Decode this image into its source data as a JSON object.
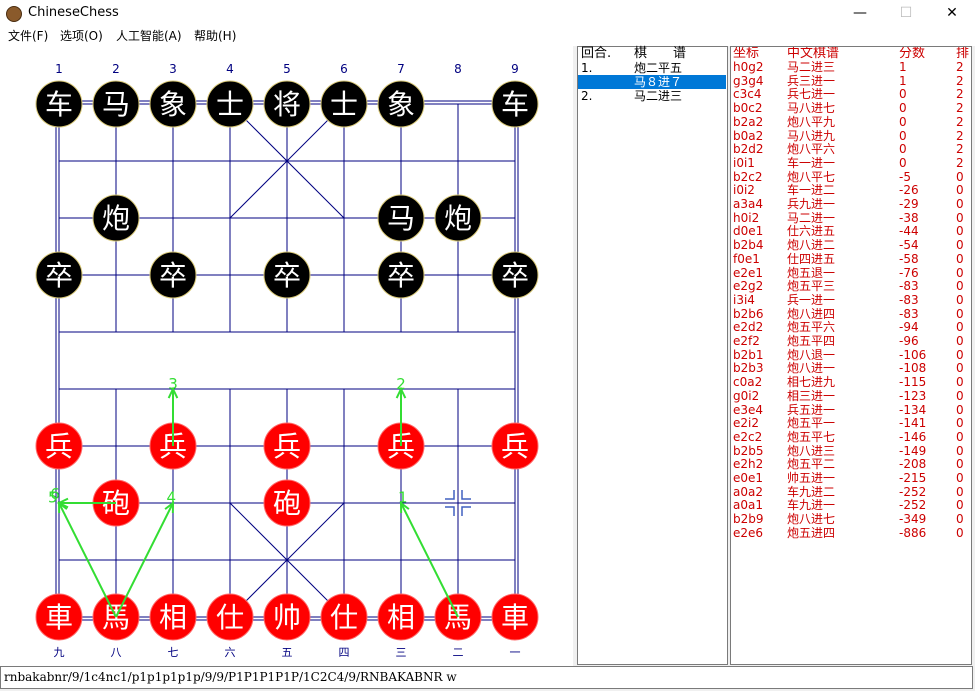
{
  "window": {
    "title": "ChineseChess",
    "minimize": "—",
    "maximize": "☐",
    "close": "✕"
  },
  "menu": [
    "文件(F)",
    "选项(O)",
    "人工智能(A)",
    "帮助(H)"
  ],
  "board": {
    "top_numbers": [
      "1",
      "2",
      "3",
      "4",
      "5",
      "6",
      "7",
      "8",
      "9"
    ],
    "bottom_numbers": [
      "九",
      "八",
      "七",
      "六",
      "五",
      "四",
      "三",
      "二",
      "一"
    ],
    "black_color": "#000000",
    "red_color": "#ff0000",
    "grid_color": "#000080",
    "arrow_color": "#33dd33",
    "pieces": [
      {
        "side": "black",
        "char": "车",
        "col": 1,
        "row": 1
      },
      {
        "side": "black",
        "char": "马",
        "col": 2,
        "row": 1
      },
      {
        "side": "black",
        "char": "象",
        "col": 3,
        "row": 1
      },
      {
        "side": "black",
        "char": "士",
        "col": 4,
        "row": 1
      },
      {
        "side": "black",
        "char": "将",
        "col": 5,
        "row": 1
      },
      {
        "side": "black",
        "char": "士",
        "col": 6,
        "row": 1
      },
      {
        "side": "black",
        "char": "象",
        "col": 7,
        "row": 1
      },
      {
        "side": "black",
        "char": "车",
        "col": 9,
        "row": 1
      },
      {
        "side": "black",
        "char": "炮",
        "col": 2,
        "row": 3
      },
      {
        "side": "black",
        "char": "马",
        "col": 7,
        "row": 3
      },
      {
        "side": "black",
        "char": "炮",
        "col": 8,
        "row": 3
      },
      {
        "side": "black",
        "char": "卒",
        "col": 1,
        "row": 4
      },
      {
        "side": "black",
        "char": "卒",
        "col": 3,
        "row": 4
      },
      {
        "side": "black",
        "char": "卒",
        "col": 5,
        "row": 4
      },
      {
        "side": "black",
        "char": "卒",
        "col": 7,
        "row": 4
      },
      {
        "side": "black",
        "char": "卒",
        "col": 9,
        "row": 4
      },
      {
        "side": "red",
        "char": "兵",
        "col": 1,
        "row": 7
      },
      {
        "side": "red",
        "char": "兵",
        "col": 3,
        "row": 7
      },
      {
        "side": "red",
        "char": "兵",
        "col": 5,
        "row": 7
      },
      {
        "side": "red",
        "char": "兵",
        "col": 7,
        "row": 7
      },
      {
        "side": "red",
        "char": "兵",
        "col": 9,
        "row": 7
      },
      {
        "side": "red",
        "char": "砲",
        "col": 2,
        "row": 8
      },
      {
        "side": "red",
        "char": "砲",
        "col": 5,
        "row": 8
      },
      {
        "side": "red",
        "char": "車",
        "col": 1,
        "row": 10
      },
      {
        "side": "red",
        "char": "馬",
        "col": 2,
        "row": 10
      },
      {
        "side": "red",
        "char": "相",
        "col": 3,
        "row": 10
      },
      {
        "side": "red",
        "char": "仕",
        "col": 4,
        "row": 10
      },
      {
        "side": "red",
        "char": "帅",
        "col": 5,
        "row": 10
      },
      {
        "side": "red",
        "char": "仕",
        "col": 6,
        "row": 10
      },
      {
        "side": "red",
        "char": "相",
        "col": 7,
        "row": 10
      },
      {
        "side": "red",
        "char": "馬",
        "col": 8,
        "row": 10
      },
      {
        "side": "red",
        "char": "車",
        "col": 9,
        "row": 10
      }
    ],
    "arrows": [
      {
        "label": "1",
        "from": [
          8,
          10
        ],
        "to": [
          7,
          8
        ]
      },
      {
        "label": "2",
        "from": [
          7,
          7
        ],
        "to": [
          7,
          6
        ]
      },
      {
        "label": "3",
        "from": [
          3,
          7
        ],
        "to": [
          3,
          6
        ]
      },
      {
        "label": "4",
        "from": [
          2,
          10
        ],
        "to": [
          3,
          8
        ]
      },
      {
        "label": "5",
        "from": [
          2,
          10
        ],
        "to": [
          1,
          8
        ]
      },
      {
        "label": "6",
        "from": [
          2,
          8
        ],
        "to": [
          1,
          8
        ]
      }
    ],
    "marker": {
      "col": 8,
      "row": 8
    }
  },
  "moves": {
    "header_round": "回合.",
    "header_notation": "棋　　谱",
    "rows": [
      {
        "num": "1.",
        "text": "炮二平五",
        "selected": false
      },
      {
        "num": "",
        "text": "马８进７",
        "selected": true
      },
      {
        "num": "2.",
        "text": "马二进三",
        "selected": false
      }
    ]
  },
  "eval": {
    "headers": [
      "坐标",
      "中文棋谱",
      "分数",
      "排"
    ],
    "rows": [
      [
        "h0g2",
        "马二进三",
        "1",
        "2"
      ],
      [
        "g3g4",
        "兵三进一",
        "1",
        "2"
      ],
      [
        "c3c4",
        "兵七进一",
        "0",
        "2"
      ],
      [
        "b0c2",
        "马八进七",
        "0",
        "2"
      ],
      [
        "b2a2",
        "炮八平九",
        "0",
        "2"
      ],
      [
        "b0a2",
        "马八进九",
        "0",
        "2"
      ],
      [
        "b2d2",
        "炮八平六",
        "0",
        "2"
      ],
      [
        "i0i1",
        "车一进一",
        "0",
        "2"
      ],
      [
        "b2c2",
        "炮八平七",
        "-5",
        "0"
      ],
      [
        "i0i2",
        "车一进二",
        "-26",
        "0"
      ],
      [
        "a3a4",
        "兵九进一",
        "-29",
        "0"
      ],
      [
        "h0i2",
        "马二进一",
        "-38",
        "0"
      ],
      [
        "d0e1",
        "仕六进五",
        "-44",
        "0"
      ],
      [
        "b2b4",
        "炮八进二",
        "-54",
        "0"
      ],
      [
        "f0e1",
        "仕四进五",
        "-58",
        "0"
      ],
      [
        "e2e1",
        "炮五退一",
        "-76",
        "0"
      ],
      [
        "e2g2",
        "炮五平三",
        "-83",
        "0"
      ],
      [
        "i3i4",
        "兵一进一",
        "-83",
        "0"
      ],
      [
        "b2b6",
        "炮八进四",
        "-83",
        "0"
      ],
      [
        "e2d2",
        "炮五平六",
        "-94",
        "0"
      ],
      [
        "e2f2",
        "炮五平四",
        "-96",
        "0"
      ],
      [
        "b2b1",
        "炮八退一",
        "-106",
        "0"
      ],
      [
        "b2b3",
        "炮八进一",
        "-108",
        "0"
      ],
      [
        "c0a2",
        "相七进九",
        "-115",
        "0"
      ],
      [
        "g0i2",
        "相三进一",
        "-123",
        "0"
      ],
      [
        "e3e4",
        "兵五进一",
        "-134",
        "0"
      ],
      [
        "e2i2",
        "炮五平一",
        "-141",
        "0"
      ],
      [
        "e2c2",
        "炮五平七",
        "-146",
        "0"
      ],
      [
        "b2b5",
        "炮八进三",
        "-149",
        "0"
      ],
      [
        "e2h2",
        "炮五平二",
        "-208",
        "0"
      ],
      [
        "e0e1",
        "帅五进一",
        "-215",
        "0"
      ],
      [
        "a0a2",
        "车九进二",
        "-252",
        "0"
      ],
      [
        "a0a1",
        "车九进一",
        "-252",
        "0"
      ],
      [
        "b2b9",
        "炮八进七",
        "-349",
        "0"
      ],
      [
        "e2e6",
        "炮五进四",
        "-886",
        "0"
      ]
    ]
  },
  "fen": "rnbakabnr/9/1c4nc1/p1p1p1p1p/9/9/P1P1P1P1P/1C2C4/9/RNBAKABNR w"
}
